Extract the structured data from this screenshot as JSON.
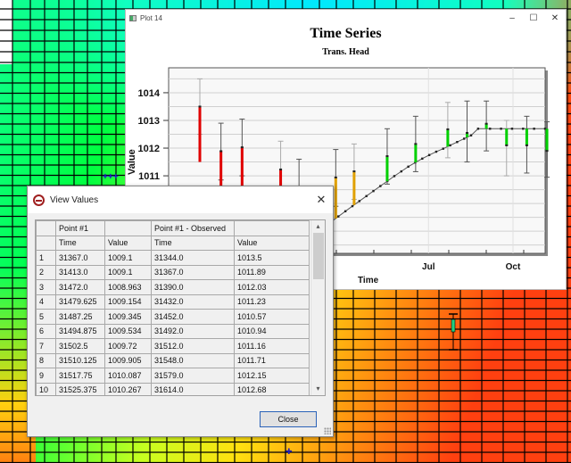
{
  "plot_window": {
    "title": "Plot 14",
    "minimize_icon": "minimize-icon",
    "maximize_icon": "maximize-icon",
    "close_icon": "close-icon"
  },
  "chart_data": {
    "type": "line",
    "title": "Time Series",
    "subtitle": "Trans. Head",
    "xlabel": "Time",
    "ylabel": "Value",
    "y_ticks": [
      1011,
      1012,
      1013,
      1014
    ],
    "x_tick_labels": [
      {
        "label": "Jul",
        "x": 31593
      },
      {
        "label": "Oct",
        "x": 31685
      }
    ],
    "xlim": [
      31310,
      31720
    ],
    "ylim": [
      1008.2,
      1014.9
    ],
    "grid": true,
    "computed_series": {
      "name": "Point #1",
      "x": [
        31367.0,
        31413.0,
        31472.0,
        31479.625,
        31487.25,
        31494.875,
        31502.5,
        31510.125,
        31517.75,
        31525.375,
        31533.0,
        31540.6,
        31548.2,
        31555.8,
        31563.4,
        31571.0,
        31578.6,
        31586.2,
        31593.8,
        31601.4,
        31609.0,
        31616.6,
        31624.2,
        31631.8,
        31639.4,
        31647.0,
        31660.0,
        31672.0,
        31684.0,
        31696.0,
        31708.0,
        31720.0
      ],
      "values": [
        1009.1,
        1009.1,
        1008.963,
        1009.154,
        1009.345,
        1009.534,
        1009.72,
        1009.905,
        1010.087,
        1010.267,
        1010.45,
        1010.63,
        1010.81,
        1010.99,
        1011.16,
        1011.33,
        1011.48,
        1011.62,
        1011.75,
        1011.87,
        1011.98,
        1012.1,
        1012.22,
        1012.34,
        1012.46,
        1012.7,
        1012.7,
        1012.7,
        1012.7,
        1012.7,
        1012.7,
        1012.7
      ]
    },
    "observed_series": {
      "name": "Point #1 - Observed",
      "x": [
        31344.0,
        31367.0,
        31390.0,
        31432.0,
        31452.0,
        31492.0,
        31512.0,
        31548.0,
        31579.0,
        31614.0,
        31635.0,
        31656.0,
        31678.0,
        31700.0,
        31722.0
      ],
      "values": [
        1013.5,
        1011.89,
        1012.03,
        1011.23,
        1010.57,
        1010.94,
        1011.16,
        1011.71,
        1012.15,
        1012.68,
        1012.55,
        1012.88,
        1012.1,
        1012.1,
        1011.9
      ],
      "error_upper": [
        1014.5,
        1012.9,
        1013.05,
        1012.25,
        1011.6,
        1011.95,
        1012.15,
        1012.7,
        1013.15,
        1013.65,
        1013.7,
        1013.7,
        1013.0,
        1013.15,
        1012.95
      ],
      "error_lower": [
        1012.5,
        1010.85,
        1011.0,
        1010.2,
        1009.55,
        1009.9,
        1010.15,
        1010.7,
        1011.15,
        1011.65,
        1011.5,
        1011.9,
        1011.0,
        1011.1,
        1010.95
      ],
      "residual_colors": [
        "#e00000",
        "#e00000",
        "#e00000",
        "#e00000",
        "#e0a000",
        "#e0a000",
        "#e0a000",
        "#00d000",
        "#00d000",
        "#00d000",
        "#00d000",
        "#00d000",
        "#00d000",
        "#00d000",
        "#00d000"
      ]
    }
  },
  "dialog": {
    "title": "View Values",
    "close_icon": "close-icon",
    "group_headers": [
      "",
      "Point #1",
      "",
      "Point #1 - Observed",
      ""
    ],
    "column_headers": [
      "",
      "Time",
      "Value",
      "Time",
      "Value"
    ],
    "rows": [
      [
        "1",
        "31367.0",
        "1009.1",
        "31344.0",
        "1013.5"
      ],
      [
        "2",
        "31413.0",
        "1009.1",
        "31367.0",
        "1011.89"
      ],
      [
        "3",
        "31472.0",
        "1008.963",
        "31390.0",
        "1012.03"
      ],
      [
        "4",
        "31479.625",
        "1009.154",
        "31432.0",
        "1011.23"
      ],
      [
        "5",
        "31487.25",
        "1009.345",
        "31452.0",
        "1010.57"
      ],
      [
        "6",
        "31494.875",
        "1009.534",
        "31492.0",
        "1010.94"
      ],
      [
        "7",
        "31502.5",
        "1009.72",
        "31512.0",
        "1011.16"
      ],
      [
        "8",
        "31510.125",
        "1009.905",
        "31548.0",
        "1011.71"
      ],
      [
        "9",
        "31517.75",
        "1010.087",
        "31579.0",
        "1012.15"
      ],
      [
        "10",
        "31525.375",
        "1010.267",
        "31614.0",
        "1012.68"
      ]
    ],
    "scroll_up": "▴",
    "scroll_down": "▾",
    "close_button": "Close"
  },
  "colors": {
    "grid_line": "#000000",
    "chart_line": "#555555",
    "button_border": "#2a62b8"
  }
}
